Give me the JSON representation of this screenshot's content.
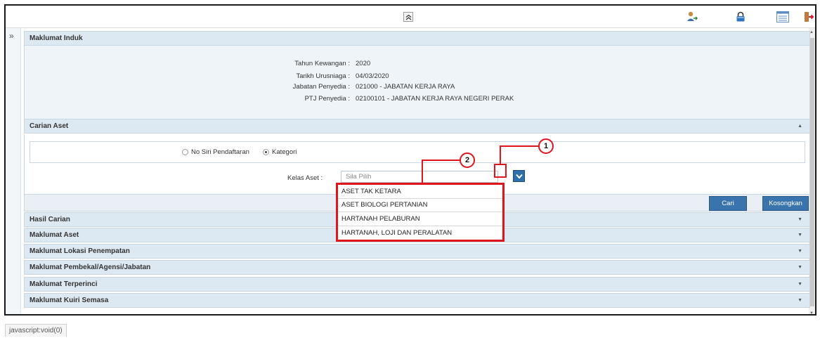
{
  "toolbar": {
    "collapse_icon": "double-chevron-up-icon",
    "icons": [
      "user-transfer-icon",
      "lock-icon",
      "list-view-icon",
      "exit-icon"
    ]
  },
  "sections": {
    "maklumat_induk": {
      "title": "Maklumat Induk",
      "rows": [
        {
          "label": "Tahun Kewangan :",
          "value": "2020"
        },
        {
          "label": "Tarikh Urusniaga :",
          "value": "04/03/2020"
        },
        {
          "label": "Jabatan Penyedia :",
          "value": "021000 - JABATAN KERJA RAYA"
        },
        {
          "label": "PTJ Penyedia :",
          "value": "02100101 - JABATAN KERJA RAYA NEGERI PERAK"
        }
      ]
    },
    "carian_aset": {
      "title": "Carian Aset",
      "radio_no_siri": "No Siri Pendaftaran",
      "radio_kategori": "Kategori",
      "selected_radio": "Kategori",
      "kelas_label": "Kelas Aset :",
      "kelas_placeholder": "Sila Pilih",
      "dropdown_options": [
        "ASET TAK KETARA",
        "ASET BIOLOGI PERTANIAN",
        "HARTANAH PELABURAN",
        "HARTANAH, LOJI DAN PERALATAN"
      ],
      "cari_button": "Cari",
      "kosongkan_button": "Kosongkan"
    },
    "collapsed": [
      "Hasil Carian",
      "Maklumat Aset",
      "Maklumat Lokasi Penempatan",
      "Maklumat Pembekal/Agensi/Jabatan",
      "Maklumat Terperinci",
      "Maklumat Kuiri Semasa"
    ]
  },
  "callouts": {
    "one": "1",
    "two": "2"
  },
  "status_text": "javascript:void(0)",
  "colors": {
    "accent": "#e0141b",
    "section_header": "#dde9f2",
    "button": "#3974ad"
  }
}
